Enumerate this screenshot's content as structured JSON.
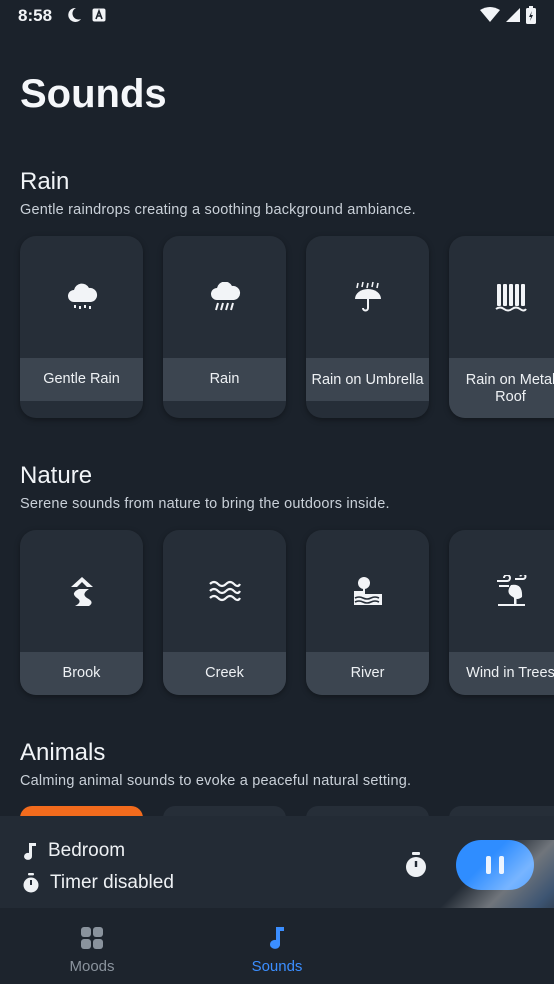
{
  "status": {
    "time": "8:58"
  },
  "page": {
    "title": "Sounds"
  },
  "sections": [
    {
      "title": "Rain",
      "description": "Gentle raindrops creating a soothing background ambiance.",
      "cards": [
        {
          "label": "Gentle Rain",
          "icon": "cloud-rain-icon"
        },
        {
          "label": "Rain",
          "icon": "cloud-showers-icon"
        },
        {
          "label": "Rain on Umbrella",
          "icon": "umbrella-rain-icon"
        },
        {
          "label": "Rain on Metal Roof",
          "icon": "metal-roof-icon"
        }
      ]
    },
    {
      "title": "Nature",
      "description": "Serene sounds from nature to bring the outdoors inside.",
      "cards": [
        {
          "label": "Brook",
          "icon": "brook-icon"
        },
        {
          "label": "Creek",
          "icon": "water-waves-icon"
        },
        {
          "label": "River",
          "icon": "river-icon"
        },
        {
          "label": "Wind in Trees",
          "icon": "wind-tree-icon"
        }
      ]
    },
    {
      "title": "Animals",
      "description": "Calming animal sounds to evoke a peaceful natural setting."
    }
  ],
  "player": {
    "room": "Bedroom",
    "timer": "Timer disabled"
  },
  "nav": {
    "moods": "Moods",
    "sounds": "Sounds"
  },
  "colors": {
    "background": "#1b222b",
    "accent": "#2f8dff",
    "animal_active": "#f26b1d"
  }
}
